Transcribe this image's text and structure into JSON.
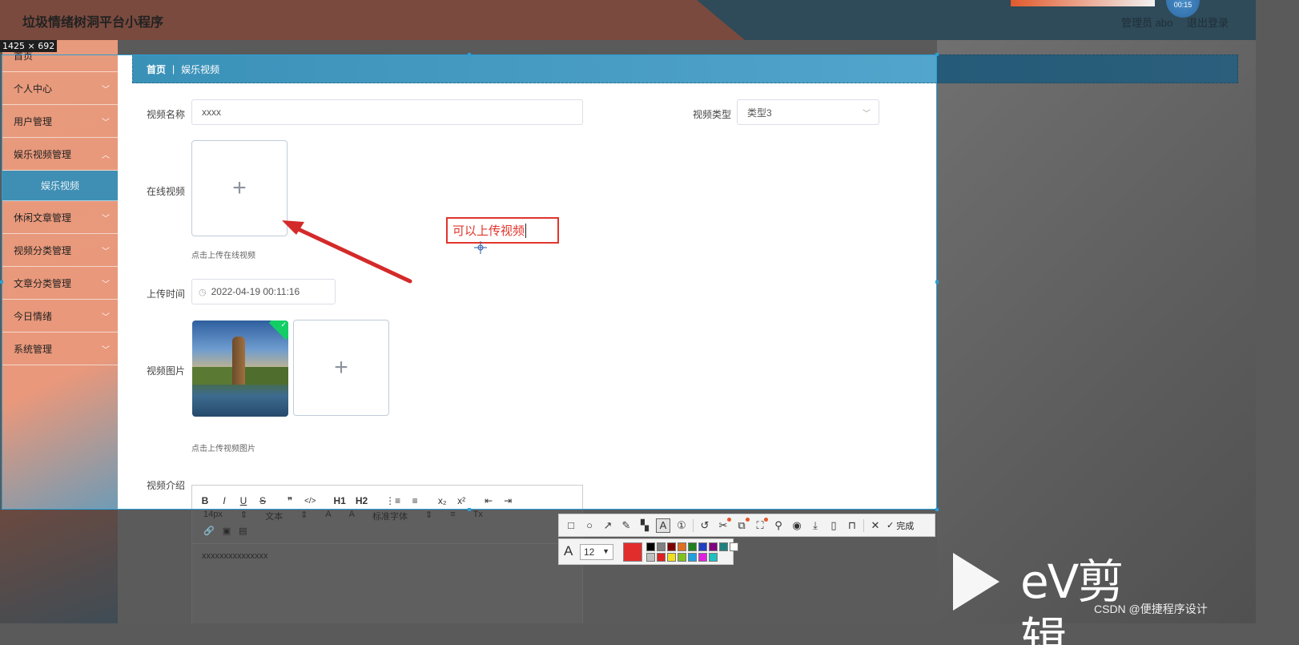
{
  "app": {
    "title": "垃圾情绪树洞平台小程序",
    "admin_label": "管理员 abo",
    "logout": "退出登录",
    "timer": "00:15",
    "size_badge": "1425 × 692"
  },
  "sidebar": {
    "items": [
      {
        "label": "首页"
      },
      {
        "label": "个人中心"
      },
      {
        "label": "用户管理"
      },
      {
        "label": "娱乐视频管理"
      },
      {
        "label": "娱乐视频",
        "sub": true
      },
      {
        "label": "休闲文章管理"
      },
      {
        "label": "视频分类管理"
      },
      {
        "label": "文章分类管理"
      },
      {
        "label": "今日情绪"
      },
      {
        "label": "系统管理"
      }
    ]
  },
  "breadcrumb": {
    "home": "首页",
    "current": "娱乐视频"
  },
  "form": {
    "name_label": "视频名称",
    "name_value": "xxxx",
    "type_label": "视频类型",
    "type_value": "类型3",
    "online_label": "在线视频",
    "online_tip": "点击上传在线视频",
    "time_label": "上传时间",
    "time_value": "2022-04-19 00:11:16",
    "image_label": "视频图片",
    "image_tip": "点击上传视频图片",
    "intro_label": "视频介绍"
  },
  "editor": {
    "toolbar": [
      "B",
      "I",
      "U",
      "S",
      "❞",
      "</>",
      "H1",
      "H2",
      "⋮≡",
      "≡",
      "x₂",
      "x²",
      "⇤",
      "⇥"
    ],
    "font_size": "14px",
    "format": "文本",
    "font_family": "标准字体",
    "content": "xxxxxxxxxxxxxxx"
  },
  "annotation": {
    "text": "可以上传视频",
    "color": "#e0352b"
  },
  "capture_toolbar": {
    "done_label": "完成",
    "font_size": "12",
    "current_color": "#e22d2d",
    "palette": [
      "#000000",
      "#808080",
      "#800000",
      "#e07020",
      "#208020",
      "#2040c0",
      "#800080",
      "#208080",
      "#ffffff",
      "#c0c0c0",
      "#e02020",
      "#f0e020",
      "#80c020",
      "#20a0e0",
      "#e020e0",
      "#20c0c0"
    ]
  },
  "watermark": {
    "ev_brand": "eV剪辑",
    "csdn": "CSDN @便捷程序设计"
  }
}
